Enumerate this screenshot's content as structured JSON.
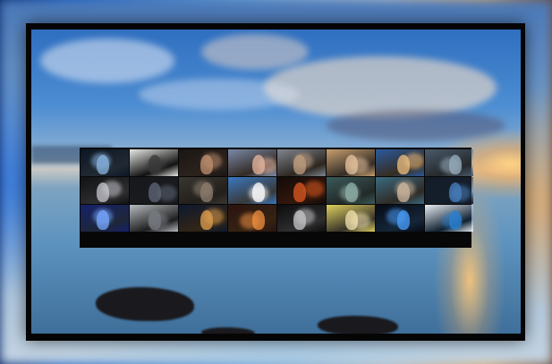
{
  "wallpaper": {
    "colors": {
      "sky": "#3b7ac6",
      "sunset": "#f5b26a",
      "water": "#6a9cc4",
      "frame": "#050505"
    }
  },
  "gallery": {
    "thumbnails": [
      {
        "subject": "armored-knight-portal",
        "bg": "#0b1626",
        "accent": "#8ab4e0"
      },
      {
        "subject": "sketch-warrior-white",
        "bg": "#e8e8e6",
        "accent": "#3a3a3a"
      },
      {
        "subject": "dark-warrior-woman",
        "bg": "#1a1614",
        "accent": "#c09070"
      },
      {
        "subject": "pier-sunset-sea",
        "bg": "#7a8aa8",
        "accent": "#e8b8a0"
      },
      {
        "subject": "warrior-woman-storm",
        "bg": "#7f8690",
        "accent": "#c0a080"
      },
      {
        "subject": "woman-face-closeup",
        "bg": "#c8a070",
        "accent": "#e8c4a0"
      },
      {
        "subject": "fantasy-lake-landscape",
        "bg": "#2a5aa0",
        "accent": "#f0c080"
      },
      {
        "subject": "coastal-road-dusk",
        "bg": "#4a5a6a",
        "accent": "#9ab0c0"
      },
      {
        "subject": "skull-orb",
        "bg": "#101214",
        "accent": "#c8c8d0"
      },
      {
        "subject": "dark-hooded-figure",
        "bg": "#16181c",
        "accent": "#606878"
      },
      {
        "subject": "mech-warrior-ruins",
        "bg": "#3a3630",
        "accent": "#908070"
      },
      {
        "subject": "blue-sky-clouds-lake",
        "bg": "#3a78c0",
        "accent": "#ffffff"
      },
      {
        "subject": "fire-demon",
        "bg": "#140a08",
        "accent": "#e05a20"
      },
      {
        "subject": "foggy-fantasy-valley",
        "bg": "#3a5a5a",
        "accent": "#90b0a8"
      },
      {
        "subject": "elf-girl-portrait",
        "bg": "#3a6a80",
        "accent": "#d0b8a0"
      },
      {
        "subject": "blue-eyed-sorceress",
        "bg": "#141c28",
        "accent": "#4a80c0"
      },
      {
        "subject": "blue-nebula-space",
        "bg": "#16206a",
        "accent": "#78a8ff"
      },
      {
        "subject": "silver-wolf-abstract",
        "bg": "#b8bcc0",
        "accent": "#787c82"
      },
      {
        "subject": "city-skyline-night",
        "bg": "#0c1830",
        "accent": "#e0a050"
      },
      {
        "subject": "fire-phoenix-woman",
        "bg": "#2a1410",
        "accent": "#f09040"
      },
      {
        "subject": "pale-face-dark",
        "bg": "#0c0c0e",
        "accent": "#c8c8cc"
      },
      {
        "subject": "anime-girl-yellow",
        "bg": "#e0d060",
        "accent": "#f4e4b0"
      },
      {
        "subject": "blue-lightning-dark",
        "bg": "#060a14",
        "accent": "#4aa0ff"
      },
      {
        "subject": "white-owl-eyes",
        "bg": "#e8eef4",
        "accent": "#2a80d0"
      }
    ]
  }
}
